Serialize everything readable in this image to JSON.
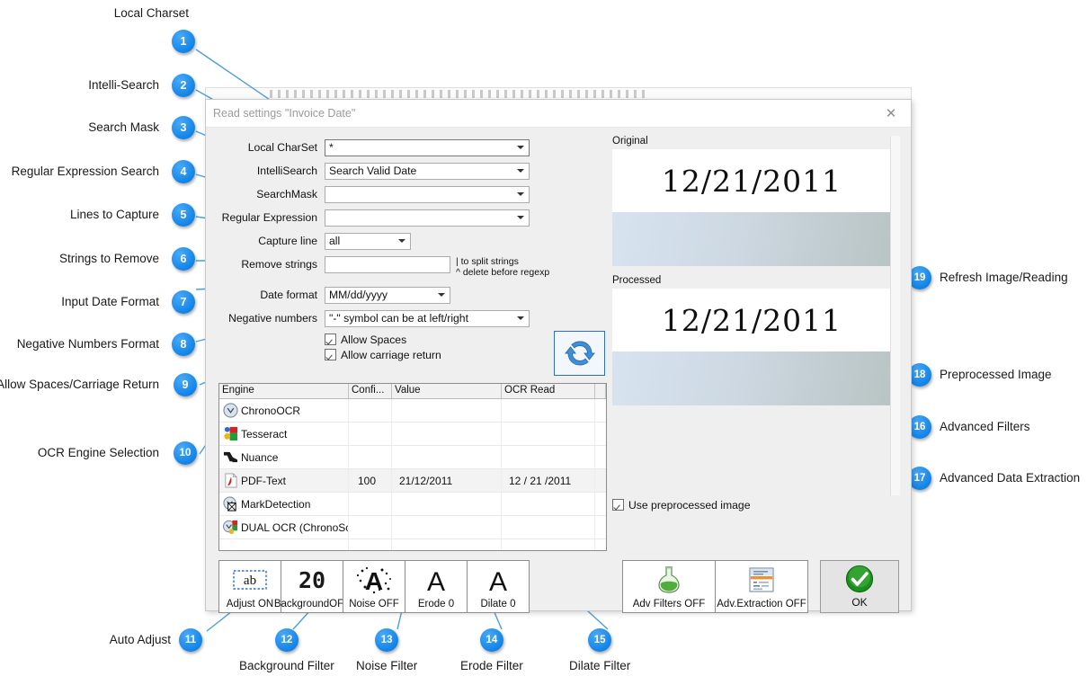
{
  "dialog": {
    "title": "Read settings \"Invoice Date\"",
    "close_icon": "close-icon"
  },
  "form": {
    "fields": [
      {
        "label": "Local CharSet",
        "value": "*",
        "type": "combo"
      },
      {
        "label": "IntelliSearch",
        "value": "Search Valid Date",
        "type": "combo"
      },
      {
        "label": "SearchMask",
        "value": "",
        "type": "combo"
      },
      {
        "label": "Regular Expression",
        "value": "",
        "type": "combo"
      },
      {
        "label": "Capture line",
        "value": "all",
        "type": "combo"
      },
      {
        "label": "Remove strings",
        "value": "",
        "type": "text"
      },
      {
        "label": "Date format",
        "value": "MM/dd/yyyy",
        "type": "combo"
      },
      {
        "label": "Negative numbers",
        "value": "\"-\" symbol can be at left/right",
        "type": "combo"
      }
    ],
    "hint_line1": "| to split strings",
    "hint_line2": "^ delete before regexp",
    "checkboxes": [
      {
        "label": "Allow Spaces",
        "checked": true
      },
      {
        "label": "Allow carriage return",
        "checked": true
      }
    ]
  },
  "refresh": {
    "icon": "refresh-icon"
  },
  "grid": {
    "columns": [
      "Engine",
      "Confi...",
      "Value",
      "OCR Read",
      ""
    ],
    "rows": [
      {
        "icon": "clock-icon",
        "engine": "ChronoOCR",
        "confidence": "",
        "value": "",
        "ocr_read": ""
      },
      {
        "icon": "tesseract-icon",
        "engine": "Tesseract",
        "confidence": "",
        "value": "",
        "ocr_read": ""
      },
      {
        "icon": "nuance-icon",
        "engine": "Nuance",
        "confidence": "",
        "value": "",
        "ocr_read": ""
      },
      {
        "icon": "pdf-icon",
        "engine": "PDF-Text",
        "confidence": "100",
        "value": "21/12/2011",
        "ocr_read": "12 / 21 /2011"
      },
      {
        "icon": "mark-icon",
        "engine": "MarkDetection",
        "confidence": "",
        "value": "",
        "ocr_read": ""
      },
      {
        "icon": "dual-icon",
        "engine": "DUAL OCR (ChronoSc...",
        "confidence": "",
        "value": "",
        "ocr_read": ""
      },
      {
        "icon": "",
        "engine": "",
        "confidence": "",
        "value": "",
        "ocr_read": ""
      },
      {
        "icon": "",
        "engine": "",
        "confidence": "",
        "value": "",
        "ocr_read": ""
      }
    ]
  },
  "filter_buttons": [
    {
      "caption": "Adjust ON",
      "icon": "ab-box-icon"
    },
    {
      "caption": "BackgroundOFF",
      "icon": "twenty-icon"
    },
    {
      "caption": "Noise OFF",
      "icon": "noisy-a-icon"
    },
    {
      "caption": "Erode 0",
      "icon": "letter-a-icon"
    },
    {
      "caption": "Dilate 0",
      "icon": "letter-a-icon"
    }
  ],
  "advanced_buttons": [
    {
      "caption": "Adv Filters OFF",
      "icon": "flask-icon"
    },
    {
      "caption": "Adv.Extraction OFF",
      "icon": "extraction-window-icon"
    }
  ],
  "ok_button": {
    "caption": "OK",
    "icon": "green-check-icon"
  },
  "preview": {
    "original_label": "Original",
    "original_text": "12/21/2011",
    "processed_label": "Processed",
    "processed_text": "12/21/2011",
    "use_preprocessed": {
      "label": "Use preprocessed image",
      "checked": true
    }
  },
  "annotations": [
    {
      "n": "1",
      "label": "Local Charset"
    },
    {
      "n": "2",
      "label": "Intelli-Search"
    },
    {
      "n": "3",
      "label": "Search Mask"
    },
    {
      "n": "4",
      "label": "Regular Expression Search"
    },
    {
      "n": "5",
      "label": "Lines to Capture"
    },
    {
      "n": "6",
      "label": "Strings to Remove"
    },
    {
      "n": "7",
      "label": "Input Date Format"
    },
    {
      "n": "8",
      "label": "Negative Numbers Format"
    },
    {
      "n": "9",
      "label": "Allow Spaces/Carriage Return"
    },
    {
      "n": "10",
      "label": "OCR Engine Selection"
    },
    {
      "n": "11",
      "label": "Auto Adjust"
    },
    {
      "n": "12",
      "label": "Background Filter"
    },
    {
      "n": "13",
      "label": "Noise Filter"
    },
    {
      "n": "14",
      "label": "Erode Filter"
    },
    {
      "n": "15",
      "label": "Dilate Filter"
    },
    {
      "n": "16",
      "label": "Advanced Filters"
    },
    {
      "n": "17",
      "label": "Advanced Data Extraction"
    },
    {
      "n": "18",
      "label": "Preprocessed Image"
    },
    {
      "n": "19",
      "label": "Refresh Image/Reading"
    }
  ],
  "colors": {
    "badge": "#1284e8",
    "leader": "#4a9fe0",
    "dialog_bg": "#efefef",
    "accent_ok": "#1ba01b"
  }
}
